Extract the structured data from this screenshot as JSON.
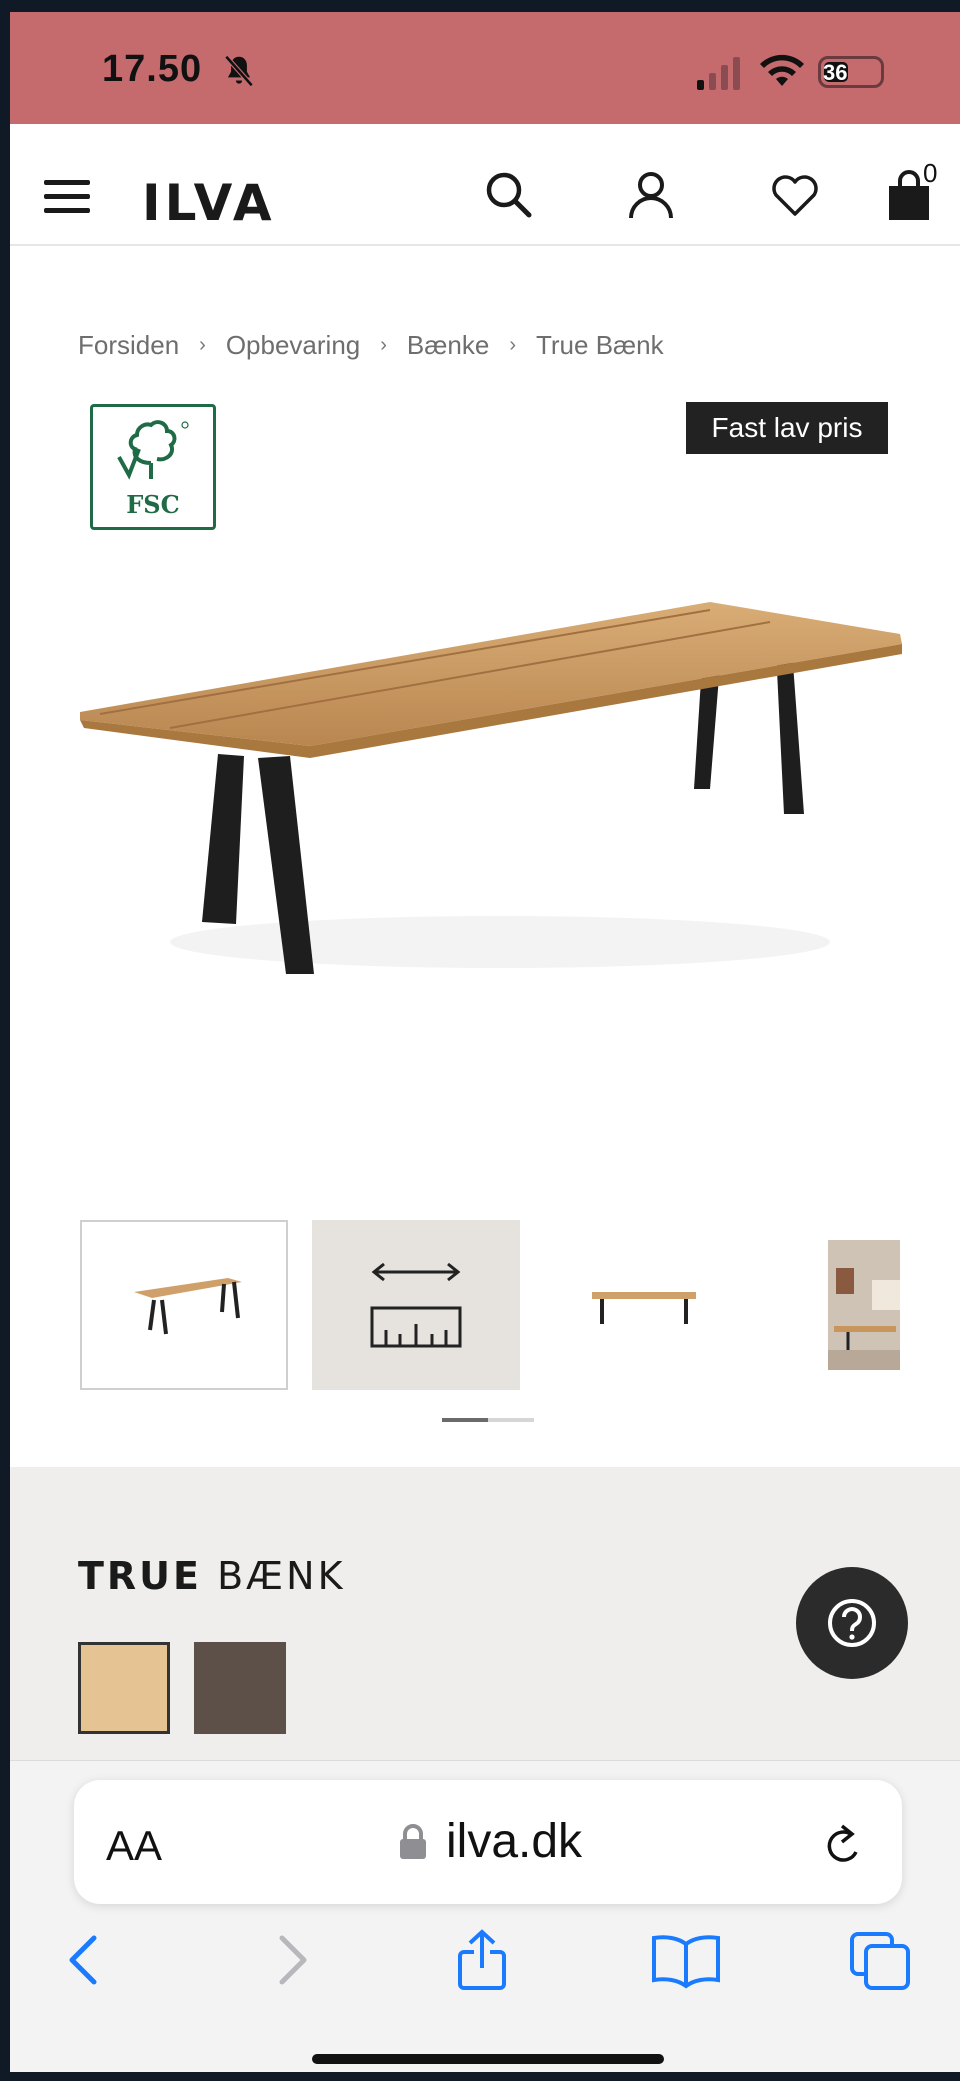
{
  "status_bar": {
    "time": "17.50",
    "battery": "36"
  },
  "header": {
    "logo": "ILVA",
    "cart_count": "0"
  },
  "breadcrumb": [
    "Forsiden",
    "Opbevaring",
    "Bænke",
    "True Bænk"
  ],
  "badges": {
    "fsc": "FSC",
    "price": "Fast lav pris"
  },
  "product": {
    "title_bold": "TRUE",
    "title_rest": " BÆNK"
  },
  "swatches": [
    {
      "color": "#e6c393"
    },
    {
      "color": "#5d5049"
    }
  ],
  "browser": {
    "text_size": "AA",
    "url": "ilva.dk"
  },
  "colors": {
    "status_bar": "#c56b6e",
    "accent_ios": "#1a7bff"
  }
}
